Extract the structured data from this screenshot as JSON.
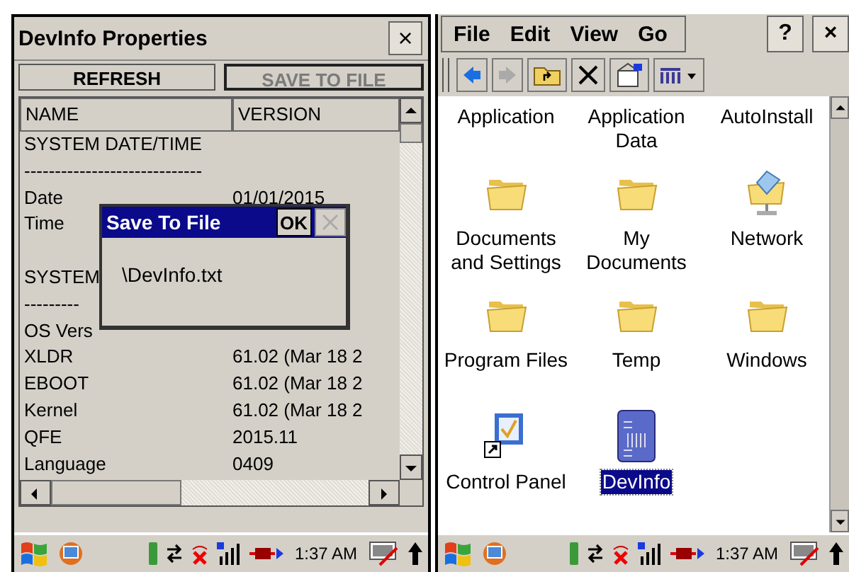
{
  "devinfo": {
    "title": "DevInfo Properties",
    "close": "×",
    "buttons": [
      {
        "label": "REFRESH",
        "disabled": false
      },
      {
        "label": "SAVE TO FILE",
        "disabled": true
      }
    ],
    "columns": [
      "NAME",
      "VERSION"
    ],
    "rows": [
      {
        "name": "SYSTEM DATE/TIME"
      },
      {
        "name": "-----------------------------"
      },
      {
        "name": "Date",
        "version": "01/01/2015"
      },
      {
        "name": "Time"
      },
      {},
      {
        "name": "SYSTEM"
      },
      {
        "name": "---------"
      },
      {
        "name": "OS Vers"
      },
      {
        "name": "XLDR",
        "version": "61.02 (Mar 18 2"
      },
      {
        "name": "EBOOT",
        "version": "61.02 (Mar 18 2"
      },
      {
        "name": "Kernel",
        "version": "61.02 (Mar 18 2"
      },
      {
        "name": "QFE",
        "version": "2015.11"
      },
      {
        "name": "Language",
        "version": "0409"
      }
    ],
    "dialog": {
      "title": "Save To File",
      "ok": "OK",
      "path": "\\DevInfo.txt"
    },
    "taskbar": {
      "time": "1:37 AM"
    }
  },
  "explorer": {
    "menu": [
      "File",
      "Edit",
      "View",
      "Go"
    ],
    "help": "?",
    "close": "×",
    "items": [
      {
        "label": "Application",
        "kind": "folder",
        "selected": false
      },
      {
        "label": "Application Data",
        "kind": "folder",
        "selected": false
      },
      {
        "label": "AutoInstall",
        "kind": "folder",
        "selected": false
      },
      {
        "label": "Documents and Settings",
        "kind": "folder",
        "selected": false
      },
      {
        "label": "My Documents",
        "kind": "folder",
        "selected": false
      },
      {
        "label": "Network",
        "kind": "network",
        "selected": false
      },
      {
        "label": "Program Files",
        "kind": "folder",
        "selected": false
      },
      {
        "label": "Temp",
        "kind": "folder",
        "selected": false
      },
      {
        "label": "Windows",
        "kind": "folder",
        "selected": false
      },
      {
        "label": "Control Panel",
        "kind": "shortcut",
        "selected": false
      },
      {
        "label": "DevInfo",
        "kind": "app",
        "selected": true
      }
    ],
    "taskbar": {
      "time": "1:37 AM"
    }
  }
}
